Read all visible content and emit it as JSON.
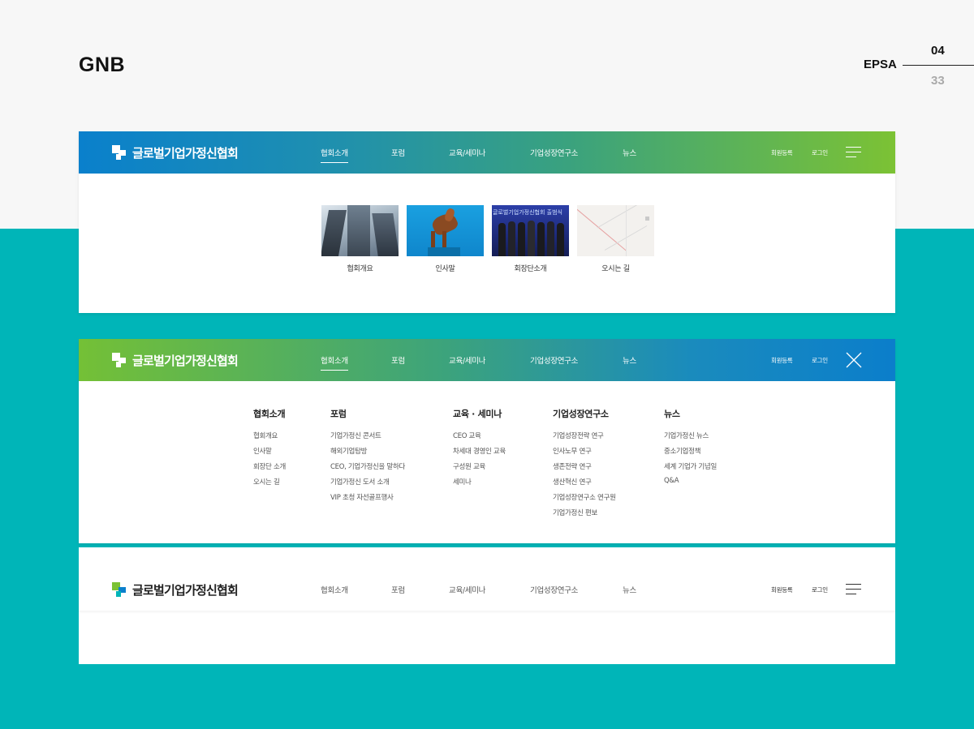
{
  "header": {
    "title": "GNB",
    "brand": "EPSA",
    "page_current": "04",
    "page_total": "33"
  },
  "colors": {
    "teal": "#00b5b8",
    "blue": "#0a80cc",
    "green": "#7cc234"
  },
  "gnb": {
    "logo_text": "글로벌기업가정신협회",
    "menu": [
      "협회소개",
      "포럼",
      "교육/세미나",
      "기업성장연구소",
      "뉴스"
    ],
    "util": [
      "회원등록",
      "로그인"
    ]
  },
  "submenu_thumbs": [
    {
      "label": "협회개요"
    },
    {
      "label": "인사말"
    },
    {
      "label": "회장단소개"
    },
    {
      "label": "오시는 길"
    }
  ],
  "thumb_banner_text": "글로벌기업가정신협회 출범식",
  "mega_menu": [
    {
      "title": "협회소개",
      "items": [
        "협회개요",
        "인사말",
        "회장단 소개",
        "오시는 길"
      ]
    },
    {
      "title": "포럼",
      "items": [
        "기업가정신 콘서트",
        "해외기업탐방",
        "CEO, 기업가정신을 말하다",
        "기업가정신 도서 소개",
        "VIP 초청 자선골프행사"
      ]
    },
    {
      "title": "교육 · 세미나",
      "items": [
        "CEO 교육",
        "차세대 경영인 교육",
        "구성원 교육",
        "세미나"
      ]
    },
    {
      "title": "기업성장연구소",
      "items": [
        "기업성장전략 연구",
        "인사노무 연구",
        "생존전략 연구",
        "생산혁신 연구",
        "기업성장연구소 연구원",
        "기업가정신 편보"
      ]
    },
    {
      "title": "뉴스",
      "items": [
        "기업가정신 뉴스",
        "중소기업정책",
        "세계 기업가 기념일",
        "Q&A"
      ]
    }
  ]
}
